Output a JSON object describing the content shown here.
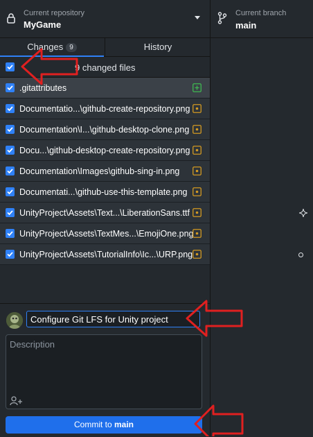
{
  "toolbar": {
    "repo_caption": "Current repository",
    "repo_name": "MyGame",
    "branch_caption": "Current branch",
    "branch_name": "main"
  },
  "tabs": [
    {
      "label": "Changes",
      "badge": "9"
    },
    {
      "label": "History"
    }
  ],
  "changes_header": {
    "label": "9 changed files"
  },
  "files": [
    {
      "path": ".gitattributes",
      "status": "added"
    },
    {
      "path": "Documentatio...\\github-create-repository.png",
      "status": "modified"
    },
    {
      "path": "Documentation\\I...\\github-desktop-clone.png",
      "status": "modified"
    },
    {
      "path": "Docu...\\github-desktop-create-repository.png",
      "status": "modified"
    },
    {
      "path": "Documentation\\Images\\github-sing-in.png",
      "status": "modified"
    },
    {
      "path": "Documentati...\\github-use-this-template.png",
      "status": "modified"
    },
    {
      "path": "UnityProject\\Assets\\Text...\\LiberationSans.ttf",
      "status": "modified"
    },
    {
      "path": "UnityProject\\Assets\\TextMes...\\EmojiOne.png",
      "status": "modified"
    },
    {
      "path": "UnityProject\\Assets\\TutorialInfo\\Ic...\\URP.png",
      "status": "modified"
    }
  ],
  "commit": {
    "summary_value": "Configure Git LFS for Unity project",
    "description_placeholder": "Description",
    "button_prefix": "Commit to ",
    "button_branch": "main"
  },
  "colors": {
    "accent": "#2f81f7",
    "commit_button": "#1f6feb",
    "added": "#3fb950",
    "modified": "#d29922",
    "annotation_arrow": "#e02020"
  }
}
